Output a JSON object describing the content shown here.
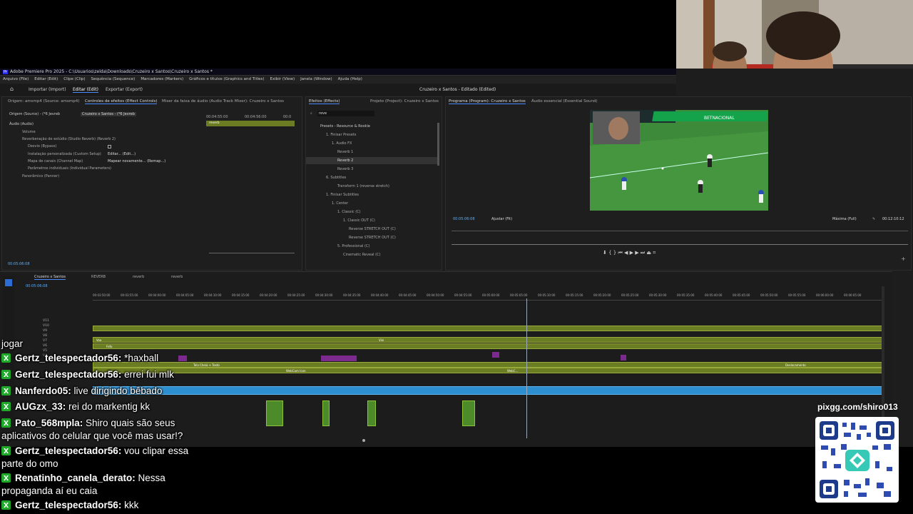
{
  "window": {
    "title": "Adobe Premiere Pro 2025 - C:\\Usuarios\\zelda\\Downloads\\Cruzeiro x Santos\\Cruzeiro x Santos *",
    "app_badge": "Pr"
  },
  "menu": [
    "Arquivo (File)",
    "Editar (Edit)",
    "Clipe (Clip)",
    "Sequência (Sequence)",
    "Marcadores (Markers)",
    "Gráficos e títulos (Graphics and Titles)",
    "Exibir (View)",
    "Janela (Window)",
    "Ajuda (Help)"
  ],
  "workspace": {
    "tabs": [
      "Importar (Import)",
      "Editar (Edit)",
      "Exportar (Export)"
    ],
    "active": "Editar (Edit)",
    "center_title": "Cruzeiro x Santos - Editado (Edited)"
  },
  "effect_controls": {
    "tabs": [
      "Origem: amsmp4 (Source: amsmp4)",
      "Controles de efeitos (Effect Controls)",
      "Mixer da faixa de áudio (Audio Track Mixer): Cruzeiro x Santos"
    ],
    "source_label": "Origem (Source) - (*6 Jevreb",
    "sequence_label": "Cruzeiro x Santos - (*6 Jevreb",
    "audio_header": "Áudio (Audio)",
    "rows": [
      "Volume",
      "Reverberação de estúdio (Studio Reverb) (Reverb 2)",
      "Desvio (Bypass)",
      "Instalação personalizada (Custom Setup)",
      "Mapa de canais (Channel Map)",
      "Parâmetros individuais (Individual Parameters)",
      "Panorâmico (Panner)"
    ],
    "edit_value": "Editar... (Edit...)",
    "map_value": "Mapear novamente... (Remap...)",
    "ruler_times": [
      "00:04:55:00",
      "00:04:56:00",
      "00:0"
    ],
    "clip_label": "reverb",
    "timecode": "00:05:06:08"
  },
  "effects": {
    "tabs": [
      "Efeitos (Effects)",
      "Projeto (Project): Cruzeiro x Santos"
    ],
    "search_value": "reve",
    "tree": [
      "Presets - Resource & Rookie",
      "1. Finisar Presets",
      "1. Audio FX",
      "Reverb 1",
      "Reverb 2",
      "Reverb 3",
      "6. Subtitles",
      "Transform 1 (reverse stretch)",
      "1. Finisar Subtitles",
      "1. Center",
      "1. Classic (C)",
      "1. Classic OUT (C)",
      "Reverse STRETCH OUT (C)",
      "Reverse STRETCH OUT (C)",
      "5. Professional (C)",
      "Cinematic Reveal (C)"
    ]
  },
  "program": {
    "tabs": [
      "Programa (Program): Cruzeiro x Santos",
      "Áudio essencial (Essential Sound)"
    ],
    "timecode": "00:05:06:08",
    "fit": "Ajustar (Fit)",
    "quality": "Máxima (Full)",
    "duration": "00:12:10:12",
    "overlay_text": "BETNACIONAL"
  },
  "timeline": {
    "tabs": [
      "Cruzeiro x Santos",
      "REVERB",
      "reverb",
      "reverb"
    ],
    "timecode": "00:05:06:08",
    "ruler": [
      "00:03:50:00",
      "00:03:55:00",
      "00:04:00:00",
      "00:04:05:00",
      "00:04:10:00",
      "00:04:15:00",
      "00:04:20:00",
      "00:04:25:00",
      "00:04:30:00",
      "00:04:35:00",
      "00:04:40:00",
      "00:04:45:00",
      "00:04:50:00",
      "00:04:55:00",
      "00:05:00:00",
      "00:05:05:00",
      "00:05:10:00",
      "00:05:15:00",
      "00:05:20:00",
      "00:05:25:00",
      "00:05:30:00",
      "00:05:35:00",
      "00:05:40:00",
      "00:05:45:00",
      "00:05:50:00",
      "00:05:55:00",
      "00:06:00:00",
      "00:06:05:00"
    ],
    "tracks": [
      "V11",
      "V10",
      "V9",
      "V8",
      "V7",
      "V6",
      "V5",
      "V4"
    ],
    "clip_labels": [
      "Vaa",
      "Fefo",
      "Tela Cheia + Texto",
      "WebCam Icon",
      "Deslocamento",
      "Vini",
      "WebC..."
    ]
  },
  "chat": [
    {
      "user": "",
      "text": "jogar"
    },
    {
      "user": "Gertz_telespectador56:",
      "text": " *haxball"
    },
    {
      "user": "Gertz_telespectador56:",
      "text": " errei fui mlk"
    },
    {
      "user": "Nanferdo05:",
      "text": " live dirigindo bêbado"
    },
    {
      "user": "AUGzx_33:",
      "text": " rei do markentig kk"
    },
    {
      "user": "Pato_568mpla:",
      "text": " Shiro quais são seus"
    },
    {
      "user": "",
      "text": "aplicativos do celular que você mas usar!?"
    },
    {
      "user": "Gertz_telespectador56:",
      "text": " vou clipar essa"
    },
    {
      "user": "",
      "text": "parte do omo"
    },
    {
      "user": "Renatinho_canela_derato:",
      "text": " Nessa"
    },
    {
      "user": "",
      "text": "propaganda aí eu caia"
    },
    {
      "user": "Gertz_telespectador56:",
      "text": " kkk"
    }
  ],
  "qr": {
    "label": "pixgg.com/shiro013"
  },
  "colors": {
    "accent": "#2d8fd0",
    "chat_badge": "#1fa82a",
    "clip_green": "#6b7d22",
    "clip_purple": "#7c2a8e"
  }
}
